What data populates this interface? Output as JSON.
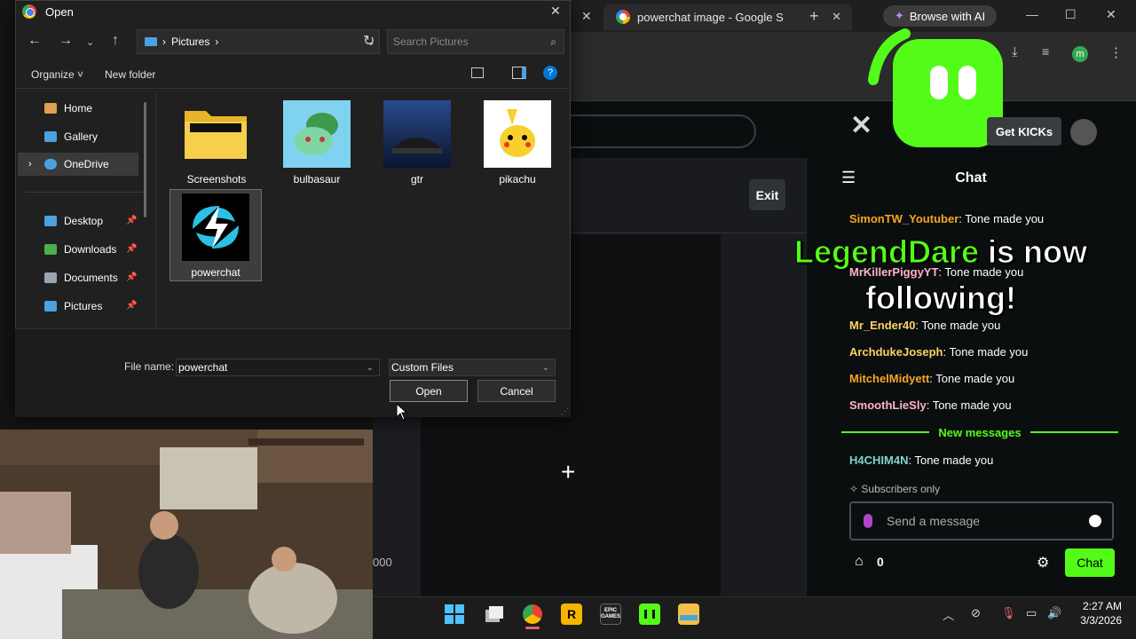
{
  "dialog": {
    "title": "Open",
    "address": "Pictures",
    "search_placeholder": "Search Pictures",
    "organize_label": "Organize",
    "new_folder_label": "New folder",
    "nav_items": [
      {
        "label": "Home"
      },
      {
        "label": "Gallery"
      },
      {
        "label": "OneDrive"
      },
      {
        "label": "Desktop"
      },
      {
        "label": "Downloads"
      },
      {
        "label": "Documents"
      },
      {
        "label": "Pictures"
      }
    ],
    "files": [
      {
        "name": "Screenshots"
      },
      {
        "name": "bulbasaur"
      },
      {
        "name": "gtr"
      },
      {
        "name": "pikachu"
      },
      {
        "name": "powerchat"
      }
    ],
    "file_name_label": "File name:",
    "file_name_value": "powerchat",
    "file_type_value": "Custom Files",
    "open_label": "Open",
    "cancel_label": "Cancel"
  },
  "browser": {
    "active_tab_title": "powerchat image - Google S",
    "ai_button_label": "Browse with AI",
    "profile_initial": "m"
  },
  "kick": {
    "exit_label": "Exit",
    "get_kicks_label": "Get KICKs",
    "partial_value": "000",
    "chat_title": "Chat",
    "chat_lines": [
      {
        "user": "SimonTW_Youtuber",
        "text": "Tone made you",
        "color": "#f5a623"
      },
      {
        "user": "MrKillerPiggyYT",
        "text": "Tone made you",
        "color": "#ffb3c6"
      },
      {
        "user": "Mr_Ender40",
        "text": "Tone made you",
        "color": "#ffd166"
      },
      {
        "user": "ArchdukeJoseph",
        "text": "Tone made you",
        "color": "#ffd166"
      },
      {
        "user": "MitchelMidyett",
        "text": "Tone made you",
        "color": "#f5a623"
      },
      {
        "user": "SmoothLieSly",
        "text": "Tone made you",
        "color": "#ffb3c6"
      }
    ],
    "new_messages_label": "New messages",
    "after_new": {
      "user": "H4CHIM4N",
      "text": "Tone made you",
      "color": "#7fd3c7"
    },
    "subscribers_only_label": "Subscribers only",
    "message_placeholder": "Send a message",
    "store_count": "0",
    "chat_button_label": "Chat",
    "follow_name": "LegendDare",
    "follow_text_1": "is now",
    "follow_text_2": "following!",
    "accent_color": "#53fc18"
  },
  "taskbar": {
    "time": "2:27 AM",
    "date": "3/3/2026",
    "rockstar_label": "R",
    "epic_label": "EPIC GAMES"
  }
}
